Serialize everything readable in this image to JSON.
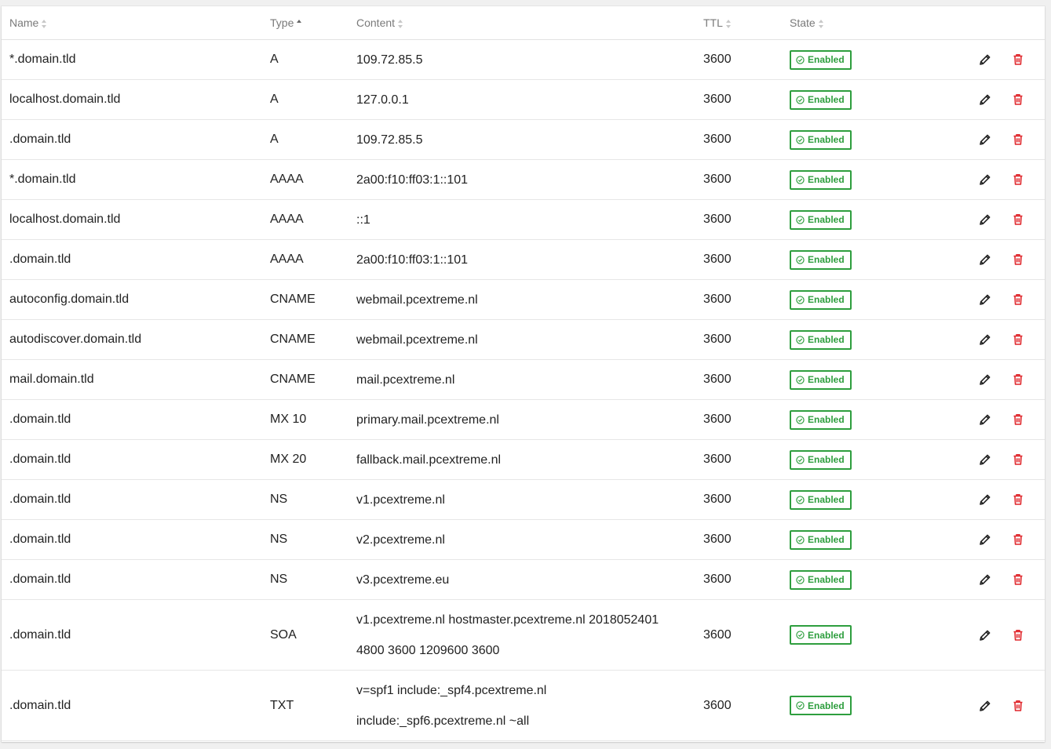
{
  "table": {
    "columns": {
      "name": "Name",
      "type": "Type",
      "content": "Content",
      "ttl": "TTL",
      "state": "State"
    },
    "sorted_column": "type",
    "sort_direction": "ascending",
    "status_color": "#2e9e3e",
    "delete_color": "#e0262b",
    "rows": [
      {
        "name": "*.domain.tld",
        "type": "A",
        "content": "109.72.85.5",
        "ttl": "3600",
        "state": "Enabled"
      },
      {
        "name": "localhost.domain.tld",
        "type": "A",
        "content": "127.0.0.1",
        "ttl": "3600",
        "state": "Enabled"
      },
      {
        "name": ".domain.tld",
        "type": "A",
        "content": "109.72.85.5",
        "ttl": "3600",
        "state": "Enabled"
      },
      {
        "name": "*.domain.tld",
        "type": "AAAA",
        "content": "2a00:f10:ff03:1::101",
        "ttl": "3600",
        "state": "Enabled"
      },
      {
        "name": "localhost.domain.tld",
        "type": "AAAA",
        "content": "::1",
        "ttl": "3600",
        "state": "Enabled"
      },
      {
        "name": ".domain.tld",
        "type": "AAAA",
        "content": "2a00:f10:ff03:1::101",
        "ttl": "3600",
        "state": "Enabled"
      },
      {
        "name": "autoconfig.domain.tld",
        "type": "CNAME",
        "content": "webmail.pcextreme.nl",
        "ttl": "3600",
        "state": "Enabled"
      },
      {
        "name": "autodiscover.domain.tld",
        "type": "CNAME",
        "content": "webmail.pcextreme.nl",
        "ttl": "3600",
        "state": "Enabled"
      },
      {
        "name": "mail.domain.tld",
        "type": "CNAME",
        "content": "mail.pcextreme.nl",
        "ttl": "3600",
        "state": "Enabled"
      },
      {
        "name": ".domain.tld",
        "type": "MX 10",
        "content": "primary.mail.pcextreme.nl",
        "ttl": "3600",
        "state": "Enabled"
      },
      {
        "name": ".domain.tld",
        "type": "MX 20",
        "content": "fallback.mail.pcextreme.nl",
        "ttl": "3600",
        "state": "Enabled"
      },
      {
        "name": ".domain.tld",
        "type": "NS",
        "content": "v1.pcextreme.nl",
        "ttl": "3600",
        "state": "Enabled"
      },
      {
        "name": ".domain.tld",
        "type": "NS",
        "content": "v2.pcextreme.nl",
        "ttl": "3600",
        "state": "Enabled"
      },
      {
        "name": ".domain.tld",
        "type": "NS",
        "content": "v3.pcextreme.eu",
        "ttl": "3600",
        "state": "Enabled"
      },
      {
        "name": ".domain.tld",
        "type": "SOA",
        "content": "v1.pcextreme.nl hostmaster.pcextreme.nl 2018052401 4800 3600 1209600 3600",
        "ttl": "3600",
        "state": "Enabled"
      },
      {
        "name": ".domain.tld",
        "type": "TXT",
        "content": "v=spf1 include:_spf4.pcextreme.nl include:_spf6.pcextreme.nl ~all",
        "ttl": "3600",
        "state": "Enabled"
      }
    ],
    "row_icons": {
      "edit": "pencil-icon",
      "delete": "trash-icon",
      "state": "check-circle-icon"
    }
  }
}
